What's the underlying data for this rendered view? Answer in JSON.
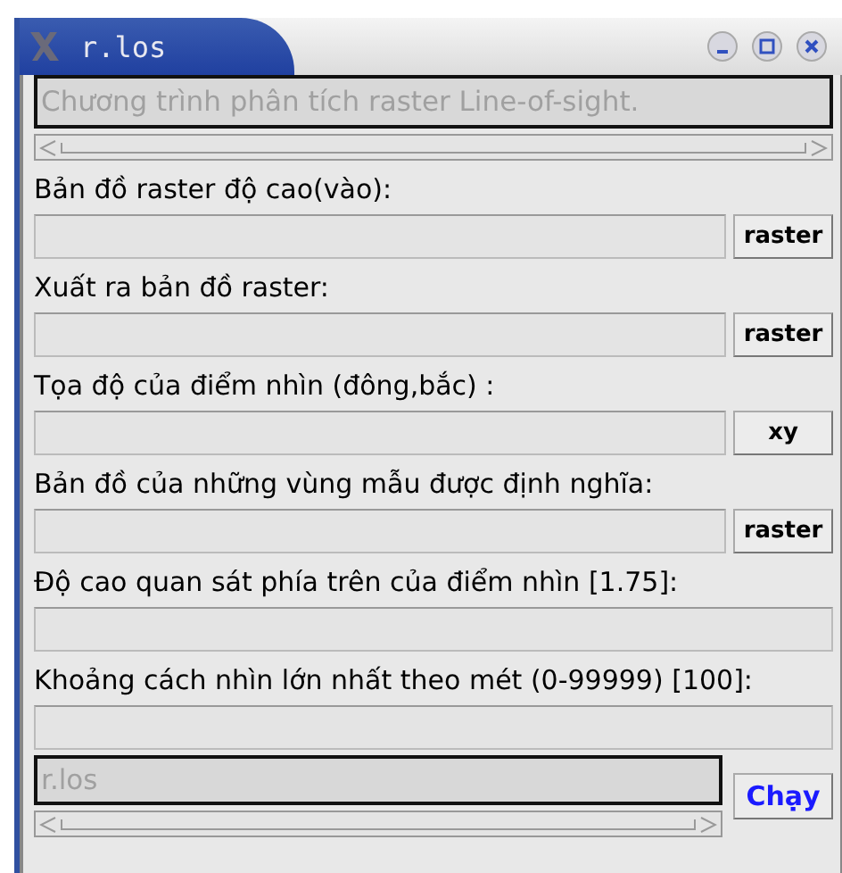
{
  "window": {
    "title": "r.los"
  },
  "description": {
    "value": "Chương trình phân tích raster Line-of-sight."
  },
  "options": [
    {
      "label": "Bản đồ raster độ cao(vào):",
      "kind": "browse",
      "button": "raster"
    },
    {
      "label": "Xuất ra bản đồ raster:",
      "kind": "browse",
      "button": "raster"
    },
    {
      "label": "Tọa độ của điểm nhìn (đông,bắc) :",
      "kind": "browse",
      "button": "xy"
    },
    {
      "label": "Bản đồ của những vùng mẫu được định nghĩa:",
      "kind": "browse",
      "button": "raster"
    },
    {
      "label": "Độ cao quan sát phía trên của điểm nhìn [1.75]:",
      "kind": "plain"
    },
    {
      "label": "Khoảng cách nhìn lớn nhất theo mét (0-99999) [100]:",
      "kind": "plain"
    }
  ],
  "command": {
    "value": "r.los"
  },
  "run_button": "Chạy"
}
